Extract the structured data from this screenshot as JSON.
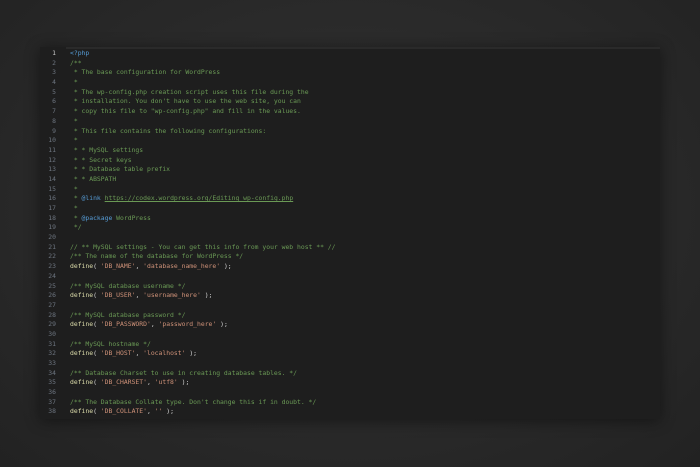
{
  "editor": {
    "lines": [
      {
        "n": "1",
        "parts": [
          {
            "t": "<?php",
            "c": "tag"
          }
        ]
      },
      {
        "n": "2",
        "parts": [
          {
            "t": "/**",
            "c": "comment"
          }
        ]
      },
      {
        "n": "3",
        "parts": [
          {
            "t": " * The base configuration for WordPress",
            "c": "comment"
          }
        ]
      },
      {
        "n": "4",
        "parts": [
          {
            "t": " *",
            "c": "comment"
          }
        ]
      },
      {
        "n": "5",
        "parts": [
          {
            "t": " * The wp-config.php creation script uses this file during the",
            "c": "comment"
          }
        ]
      },
      {
        "n": "6",
        "parts": [
          {
            "t": " * installation. You don't have to use the web site, you can",
            "c": "comment"
          }
        ]
      },
      {
        "n": "7",
        "parts": [
          {
            "t": " * copy this file to \"wp-config.php\" and fill in the values.",
            "c": "comment"
          }
        ]
      },
      {
        "n": "8",
        "parts": [
          {
            "t": " *",
            "c": "comment"
          }
        ]
      },
      {
        "n": "9",
        "parts": [
          {
            "t": " * This file contains the following configurations:",
            "c": "comment"
          }
        ]
      },
      {
        "n": "10",
        "parts": [
          {
            "t": " *",
            "c": "comment"
          }
        ]
      },
      {
        "n": "11",
        "parts": [
          {
            "t": " * * MySQL settings",
            "c": "comment"
          }
        ]
      },
      {
        "n": "12",
        "parts": [
          {
            "t": " * * Secret keys",
            "c": "comment"
          }
        ]
      },
      {
        "n": "13",
        "parts": [
          {
            "t": " * * Database table prefix",
            "c": "comment"
          }
        ]
      },
      {
        "n": "14",
        "parts": [
          {
            "t": " * * ABSPATH",
            "c": "comment"
          }
        ]
      },
      {
        "n": "15",
        "parts": [
          {
            "t": " *",
            "c": "comment"
          }
        ]
      },
      {
        "n": "16",
        "parts": [
          {
            "t": " * ",
            "c": "comment"
          },
          {
            "t": "@link",
            "c": "doc"
          },
          {
            "t": " ",
            "c": "comment"
          },
          {
            "t": "https://codex.wordpress.org/Editing_wp-config.php",
            "c": "link"
          }
        ]
      },
      {
        "n": "17",
        "parts": [
          {
            "t": " *",
            "c": "comment"
          }
        ]
      },
      {
        "n": "18",
        "parts": [
          {
            "t": " * ",
            "c": "comment"
          },
          {
            "t": "@package",
            "c": "doc"
          },
          {
            "t": " WordPress",
            "c": "comment"
          }
        ]
      },
      {
        "n": "19",
        "parts": [
          {
            "t": " */",
            "c": "comment"
          }
        ]
      },
      {
        "n": "20",
        "parts": []
      },
      {
        "n": "21",
        "parts": [
          {
            "t": "// ** MySQL settings - You can get this info from your web host ** //",
            "c": "comment"
          }
        ]
      },
      {
        "n": "22",
        "parts": [
          {
            "t": "/** The name of the database for WordPress */",
            "c": "comment"
          }
        ]
      },
      {
        "n": "23",
        "parts": [
          {
            "t": "define",
            "c": "fn"
          },
          {
            "t": "( ",
            "c": "punc"
          },
          {
            "t": "'DB_NAME'",
            "c": "str"
          },
          {
            "t": ", ",
            "c": "punc"
          },
          {
            "t": "'database_name_here'",
            "c": "str"
          },
          {
            "t": " );",
            "c": "punc"
          }
        ]
      },
      {
        "n": "24",
        "parts": []
      },
      {
        "n": "25",
        "parts": [
          {
            "t": "/** MySQL database username */",
            "c": "comment"
          }
        ]
      },
      {
        "n": "26",
        "parts": [
          {
            "t": "define",
            "c": "fn"
          },
          {
            "t": "( ",
            "c": "punc"
          },
          {
            "t": "'DB_USER'",
            "c": "str"
          },
          {
            "t": ", ",
            "c": "punc"
          },
          {
            "t": "'username_here'",
            "c": "str"
          },
          {
            "t": " );",
            "c": "punc"
          }
        ]
      },
      {
        "n": "27",
        "parts": []
      },
      {
        "n": "28",
        "parts": [
          {
            "t": "/** MySQL database password */",
            "c": "comment"
          }
        ]
      },
      {
        "n": "29",
        "parts": [
          {
            "t": "define",
            "c": "fn"
          },
          {
            "t": "( ",
            "c": "punc"
          },
          {
            "t": "'DB_PASSWORD'",
            "c": "str"
          },
          {
            "t": ", ",
            "c": "punc"
          },
          {
            "t": "'password_here'",
            "c": "str"
          },
          {
            "t": " );",
            "c": "punc"
          }
        ]
      },
      {
        "n": "30",
        "parts": []
      },
      {
        "n": "31",
        "parts": [
          {
            "t": "/** MySQL hostname */",
            "c": "comment"
          }
        ]
      },
      {
        "n": "32",
        "parts": [
          {
            "t": "define",
            "c": "fn"
          },
          {
            "t": "( ",
            "c": "punc"
          },
          {
            "t": "'DB_HOST'",
            "c": "str"
          },
          {
            "t": ", ",
            "c": "punc"
          },
          {
            "t": "'localhost'",
            "c": "str"
          },
          {
            "t": " );",
            "c": "punc"
          }
        ]
      },
      {
        "n": "33",
        "parts": []
      },
      {
        "n": "34",
        "parts": [
          {
            "t": "/** Database Charset to use in creating database tables. */",
            "c": "comment"
          }
        ]
      },
      {
        "n": "35",
        "parts": [
          {
            "t": "define",
            "c": "fn"
          },
          {
            "t": "( ",
            "c": "punc"
          },
          {
            "t": "'DB_CHARSET'",
            "c": "str"
          },
          {
            "t": ", ",
            "c": "punc"
          },
          {
            "t": "'utf8'",
            "c": "str"
          },
          {
            "t": " );",
            "c": "punc"
          }
        ]
      },
      {
        "n": "36",
        "parts": []
      },
      {
        "n": "37",
        "parts": [
          {
            "t": "/** The Database Collate type. Don't change this if in doubt. */",
            "c": "comment"
          }
        ]
      },
      {
        "n": "38",
        "parts": [
          {
            "t": "define",
            "c": "fn"
          },
          {
            "t": "( ",
            "c": "punc"
          },
          {
            "t": "'DB_COLLATE'",
            "c": "str"
          },
          {
            "t": ", ",
            "c": "punc"
          },
          {
            "t": "''",
            "c": "str"
          },
          {
            "t": " );",
            "c": "punc"
          }
        ]
      }
    ],
    "active_line": "1",
    "colors": {
      "background": "#1e1e1e",
      "comment": "#6a9955",
      "tag": "#569cd6",
      "function": "#dcdcaa",
      "string": "#ce9178"
    }
  }
}
